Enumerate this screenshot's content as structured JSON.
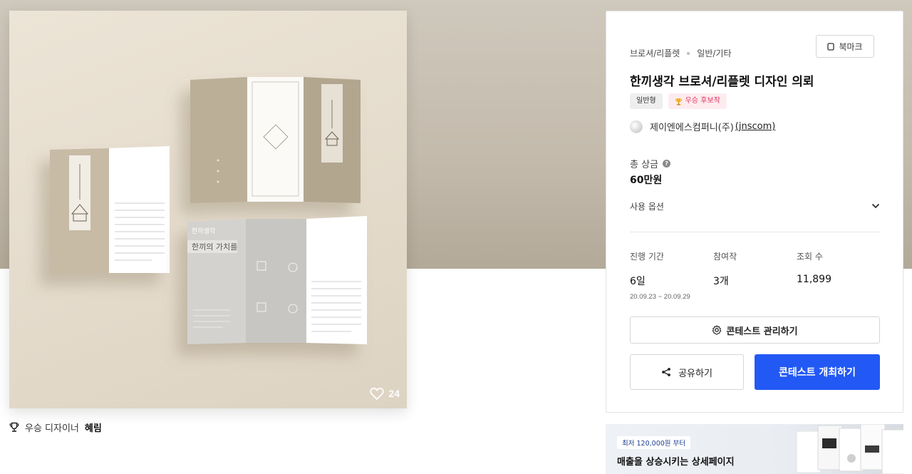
{
  "main_image": {
    "like_count": "24",
    "leaflet_heading": "한끼의 가치를",
    "leaflet_brand": "한끼생각"
  },
  "award": {
    "prefix": "우승 디자이너",
    "designer": "혜림"
  },
  "contest": {
    "category_main": "브로셔/리플렛",
    "category_sub": "일반/기타",
    "bookmark_label": "북마크",
    "title": "한끼생각 브로셔/리플렛 디자인 의뢰",
    "tags": [
      "일반형",
      "우승 후보작"
    ],
    "company_name": "제이엔에스컴퍼니(주)",
    "company_handle": "(jnscom)",
    "prize_label": "총 상금",
    "prize_value": "60만원",
    "options_label": "사용 옵션",
    "stats": [
      {
        "label": "진행 기간",
        "value": "6일",
        "sub": "20.09.23 ~ 20.09.29"
      },
      {
        "label": "참여작",
        "value": "3개",
        "sub": ""
      },
      {
        "label": "조회 수",
        "value": "11,899",
        "sub": ""
      }
    ],
    "manage_button": "콘테스트 관리하기",
    "share_button": "공유하기",
    "host_button": "콘테스트 개최하기",
    "accent_color": "#2259f5"
  },
  "ad": {
    "price_text": "최저 120,000원 부터",
    "title": "매출을 상승시키는 상세페이지"
  }
}
